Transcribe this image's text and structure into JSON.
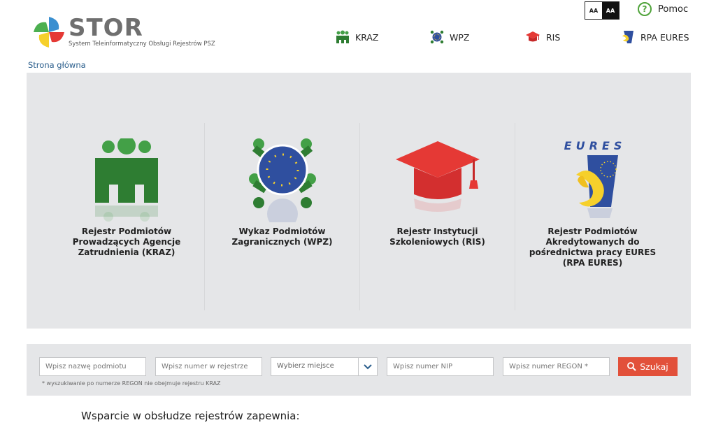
{
  "logo": {
    "title": "STOR",
    "subtitle": "System Teleinformatyczny Obsługi Rejestrów PSZ"
  },
  "contrast": {
    "normal": "AA",
    "high": "AA"
  },
  "help": {
    "label": "Pomoc"
  },
  "topnav": [
    {
      "label": "KRAZ",
      "icon": "people-icon"
    },
    {
      "label": "WPZ",
      "icon": "eu-people-icon"
    },
    {
      "label": "RIS",
      "icon": "graduation-cap-icon"
    },
    {
      "label": "RPA EURES",
      "icon": "eures-icon"
    }
  ],
  "breadcrumb": {
    "home": "Strona główna"
  },
  "registers": [
    {
      "name": "Rejestr Podmiotów Prowadzących Agencje Zatrudnienia (KRAZ)",
      "icon": "people-icon"
    },
    {
      "name": "Wykaz Podmiotów Zagranicznych (WPZ)",
      "icon": "eu-people-icon"
    },
    {
      "name": "Rejestr Instytucji Szkoleniowych (RIS)",
      "icon": "graduation-cap-icon"
    },
    {
      "name": "Rejestr Podmiotów Akredytowanych do pośrednictwa pracy EURES (RPA EURES)",
      "icon": "eures-icon"
    }
  ],
  "search": {
    "name_placeholder": "Wpisz nazwę podmiotu",
    "number_placeholder": "Wpisz numer w rejestrze",
    "place_value": "Wybierz miejsce",
    "nip_placeholder": "Wpisz numer NIP",
    "regon_placeholder": "Wpisz numer REGON *",
    "button_label": "Szukaj",
    "note": "* wyszukiwanie po numerze REGON nie obejmuje rejestru KRAZ"
  },
  "support": {
    "heading": "Wsparcie w obsłudze rejestrów zapewnia:"
  },
  "colors": {
    "green": "#2e7d32",
    "green_light": "#43a047",
    "red": "#e53935",
    "eu_blue": "#2f4f9f",
    "yellow": "#f6d02b",
    "search_button": "#e2503a",
    "link": "#2a5e8c"
  }
}
